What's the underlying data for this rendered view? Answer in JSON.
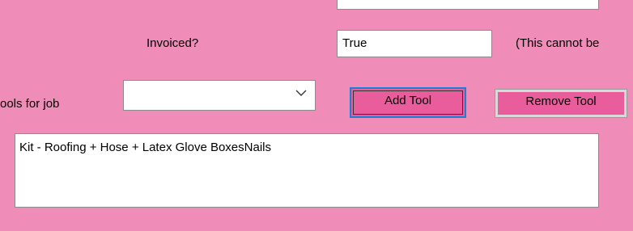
{
  "form": {
    "invoiced_label": "Invoiced?",
    "invoiced_value": "True",
    "cannot_change_note": "(This cannot be",
    "tools_label": "ools for job",
    "tools_combo_value": "",
    "add_tool_label": "Add Tool",
    "remove_tool_label": "Remove Tool",
    "tools_list": [
      "Kit - Roofing + Hose + Latex Glove BoxesNails"
    ]
  },
  "colors": {
    "background": "#f08cb8",
    "button_fill": "#ea5d9d",
    "focus_border": "#1c7fd6"
  },
  "icons": {
    "combo_dropdown": "chevron-down-icon"
  }
}
